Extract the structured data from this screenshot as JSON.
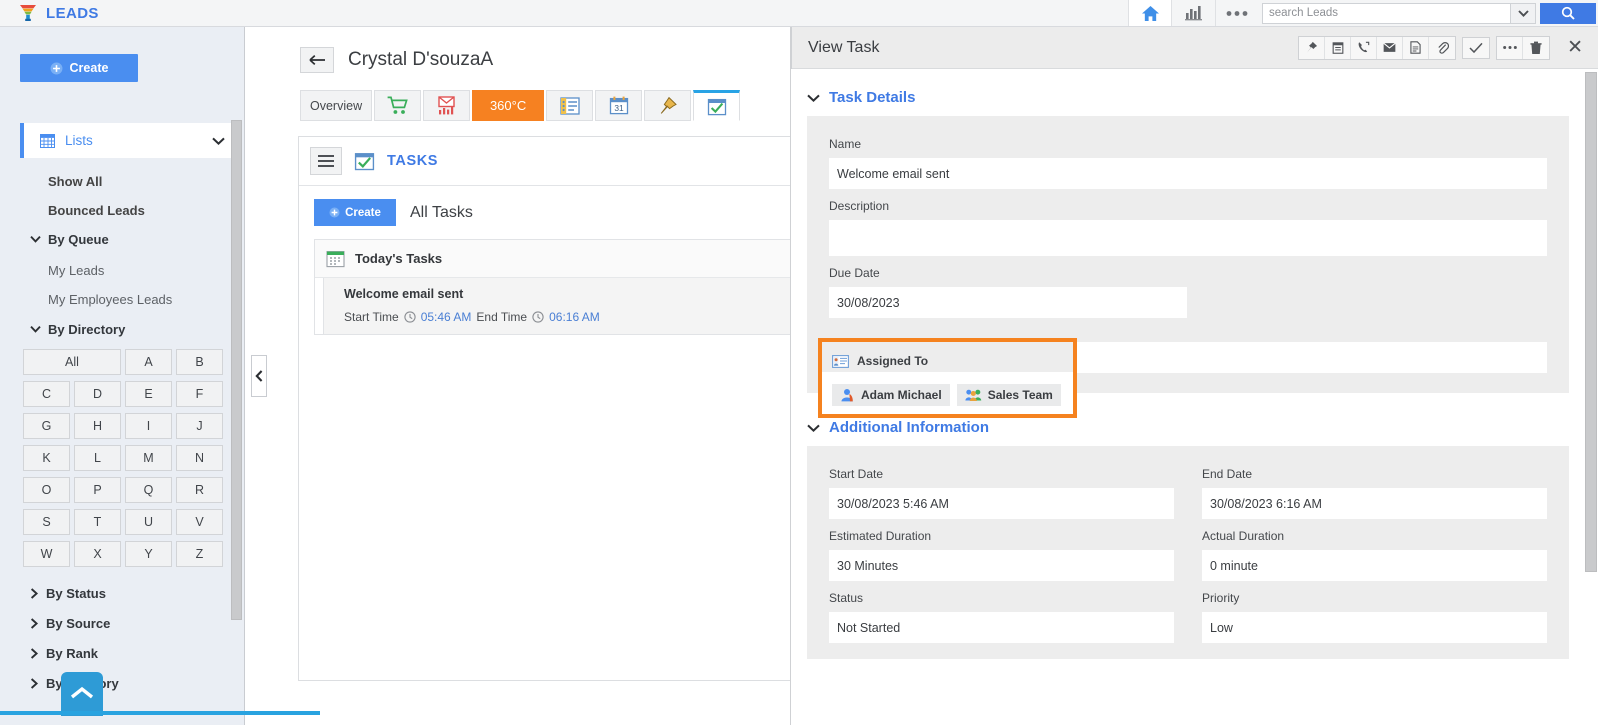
{
  "header": {
    "logo_text": "LEADS",
    "logo_icon": "funnel-icon",
    "home_icon": "home-icon",
    "reports_icon": "bar-chart-icon",
    "more_icon": "ellipsis-icon",
    "search_placeholder": "search Leads",
    "search_value": "",
    "search_caret_icon": "chevron-down-icon",
    "search_button_icon": "search-icon"
  },
  "sidebar": {
    "create_label": "Create",
    "lists_label": "Lists",
    "lists_icon": "grid-icon",
    "lists_chevron": "chevron-down-icon",
    "items": [
      {
        "label": "Show All",
        "type": "child"
      },
      {
        "label": "Bounced Leads",
        "type": "child"
      },
      {
        "label": "By Queue",
        "type": "group",
        "expanded": true
      },
      {
        "label": "My Leads",
        "type": "childl"
      },
      {
        "label": "My Employees Leads",
        "type": "childl"
      },
      {
        "label": "By Directory",
        "type": "group",
        "expanded": true
      }
    ],
    "alphabet": [
      "All",
      "A",
      "B",
      "C",
      "D",
      "E",
      "F",
      "G",
      "H",
      "I",
      "J",
      "K",
      "L",
      "M",
      "N",
      "O",
      "P",
      "Q",
      "R",
      "S",
      "T",
      "U",
      "V",
      "W",
      "X",
      "Y",
      "Z"
    ],
    "groups_bottom": [
      {
        "label": "By Status",
        "expanded": false
      },
      {
        "label": "By Source",
        "expanded": false
      },
      {
        "label": "By Rank",
        "expanded": false
      },
      {
        "label": "By Territory",
        "expanded": false
      }
    ],
    "scroll_top_icon": "chevron-up-icon"
  },
  "collapse_handle": {
    "icon": "chevron-left-icon"
  },
  "main": {
    "back_icon": "arrow-left-icon",
    "record_title": "Crystal D'souzaA",
    "tabs": [
      {
        "label": "Overview",
        "icon": "",
        "active": false,
        "style": "text"
      },
      {
        "label": "",
        "icon": "cart-icon",
        "active": false,
        "style": "icon"
      },
      {
        "label": "",
        "icon": "email-chart-icon",
        "active": false,
        "style": "icon"
      },
      {
        "label": "360°C",
        "icon": "refresh-icon",
        "active": false,
        "style": "orange"
      },
      {
        "label": "",
        "icon": "form-icon",
        "active": false,
        "style": "icon"
      },
      {
        "label": "",
        "icon": "calendar-31-icon",
        "active": false,
        "style": "icon"
      },
      {
        "label": "",
        "icon": "pin-icon",
        "active": false,
        "style": "icon"
      },
      {
        "label": "",
        "icon": "task-check-icon",
        "active": true,
        "style": "icon"
      }
    ],
    "panel": {
      "menu_icon": "hamburger-icon",
      "title_icon": "task-check-icon",
      "title": "TASKS",
      "create_label": "Create",
      "list_title": "All Tasks",
      "group": {
        "icon": "calendar-icon",
        "title": "Today's Tasks",
        "task": {
          "name": "Welcome email sent",
          "start_label": "Start Time",
          "start_value": "05:46 AM",
          "end_label": "End Time",
          "end_value": "06:16 AM",
          "clock_icon": "clock-icon"
        }
      }
    }
  },
  "task_panel": {
    "title": "View Task",
    "tools_group1": [
      {
        "name": "pin-icon",
        "glyph": "pin"
      },
      {
        "name": "note-icon",
        "glyph": "note"
      },
      {
        "name": "phone-icon",
        "glyph": "phone"
      },
      {
        "name": "envelope-icon",
        "glyph": "envelope"
      },
      {
        "name": "document-icon",
        "glyph": "document"
      },
      {
        "name": "attachment-icon",
        "glyph": "clip"
      }
    ],
    "tools_group2": [
      {
        "name": "complete-check-icon",
        "glyph": "check"
      }
    ],
    "tools_group3": [
      {
        "name": "more-options-icon",
        "glyph": "ellipsis"
      },
      {
        "name": "delete-icon",
        "glyph": "trash"
      }
    ],
    "close_icon": "close-icon",
    "section_task_details": {
      "title": "Task Details",
      "chevron": "chevron-down-icon",
      "fields": {
        "name_label": "Name",
        "name_value": "Welcome email sent",
        "description_label": "Description",
        "description_value": "",
        "due_date_label": "Due Date",
        "due_date_value": "30/08/2023",
        "extra_value": ""
      }
    },
    "assigned_to": {
      "label": "Assigned To",
      "icon": "contact-card-icon",
      "highlight_color": "#f5821f",
      "chips": [
        {
          "label": "Adam Michael",
          "icon": "user-icon"
        },
        {
          "label": "Sales Team",
          "icon": "group-icon"
        }
      ]
    },
    "section_additional": {
      "title": "Additional Information",
      "chevron": "chevron-down-icon",
      "fields": [
        {
          "label": "Start Date",
          "value": "30/08/2023 5:46 AM"
        },
        {
          "label": "End Date",
          "value": "30/08/2023 6:16 AM"
        },
        {
          "label": "Estimated Duration",
          "value": "30 Minutes"
        },
        {
          "label": "Actual Duration",
          "value": "0 minute"
        },
        {
          "label": "Status",
          "value": "Not Started"
        },
        {
          "label": "Priority",
          "value": "Low"
        }
      ]
    }
  },
  "colors": {
    "brand_blue": "#3f7ae4",
    "accent_orange": "#f5821f",
    "tab_orange": "#f68121",
    "active_tab_blue": "#28a3e5",
    "sidebar_bg": "#eaeef4"
  }
}
